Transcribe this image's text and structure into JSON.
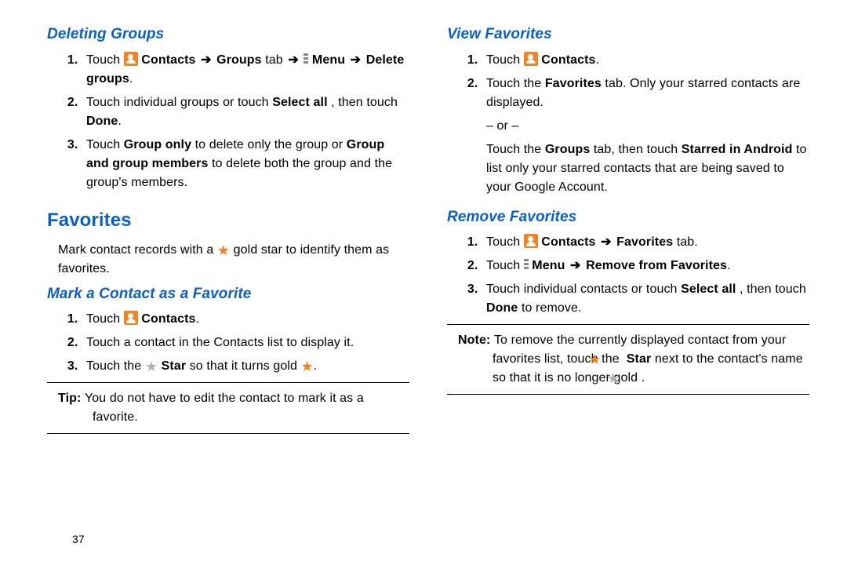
{
  "page_number": "37",
  "arrow": " ➔ ",
  "left": {
    "h_deleting_groups": "Deleting Groups",
    "dg": {
      "s1a": "Touch ",
      "s1b": " Contacts",
      "s1c": "Groups",
      "s1c2": " tab ",
      "s1d": " Menu",
      "s1e": "Delete groups",
      "s2a": "Touch individual groups or touch ",
      "s2b": "Select all",
      "s2c": ", then touch ",
      "s2d": "Done",
      "s3a": "Touch ",
      "s3b": "Group only",
      "s3c": " to delete only the group or ",
      "s3d": "Group and group members",
      "s3e": " to delete both the group and the group's members."
    },
    "h_favorites": "Favorites",
    "fav_intro_a": "Mark contact records with a ",
    "fav_intro_b": " gold star to identify them as favorites.",
    "h_mark": "Mark a Contact as a Favorite",
    "mk": {
      "s1a": "Touch ",
      "s1b": " Contacts",
      "s2": "Touch a contact in the Contacts list  to display it.",
      "s3a": "Touch the ",
      "s3b": " Star",
      "s3c": " so that it turns gold "
    },
    "tip_label": "Tip: ",
    "tip": "You do not have to edit the contact to mark it as a favorite."
  },
  "right": {
    "h_view": "View Favorites",
    "vw": {
      "s1a": "Touch ",
      "s1b": " Contacts",
      "s2a": "Touch the ",
      "s2b": "Favorites",
      "s2c": " tab. Only your starred contacts are displayed.",
      "or": "– or –",
      "s2d": "Touch the ",
      "s2e": "Groups",
      "s2f": " tab, then touch ",
      "s2g": "Starred in Android",
      "s2h": " to list only your starred contacts that are being saved to your Google Account."
    },
    "h_remove": "Remove Favorites",
    "rm": {
      "s1a": "Touch ",
      "s1b": " Contacts",
      "s1c": "Favorites",
      "s1c2": " tab.",
      "s2a": "Touch ",
      "s2b": " Menu",
      "s2c": "Remove from Favorites",
      "s3a": "Touch individual contacts or touch ",
      "s3b": "Select all",
      "s3c": ", then touch ",
      "s3d": "Done",
      "s3e": " to remove."
    },
    "note_label": "Note: ",
    "note_a": "To remove the currently displayed contact from your favorites list, touch the ",
    "note_b": " Star",
    "note_c": " next to the contact's name so that it is no longer gold "
  }
}
